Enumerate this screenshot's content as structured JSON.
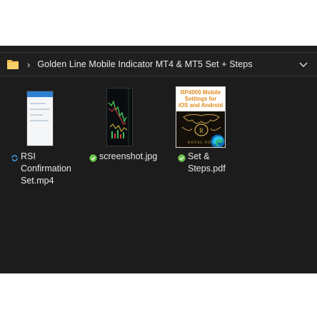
{
  "address_bar": {
    "separator": "›",
    "path": "Golden Line Mobile Indicator MT4 & MT5 Set + Steps",
    "folder_icon": "folder-icon",
    "expand_icon": "chevron-down-icon"
  },
  "files": [
    {
      "name_line1": "RSI",
      "name_line2": "Confirmation",
      "name_line3": "Set.mp4",
      "status_icon": "sync-icon",
      "status_color": "#3b9be6"
    },
    {
      "name_line1": "screenshot.jpg",
      "status_icon": "check-circle-icon",
      "status_color": "#6cc24a"
    },
    {
      "name_line1": "Set &",
      "name_line2": "Steps.pdf",
      "status_icon": "check-circle-icon",
      "status_color": "#6cc24a",
      "thumbnail_text_line1": "RP4000 Mobile",
      "thumbnail_text_line2": "Settings for",
      "thumbnail_text_line3": "iOS and Android",
      "thumbnail_brand": "ROYAL PIPS",
      "overlay_icon": "edge-browser-icon"
    }
  ],
  "colors": {
    "background": "#1c1c1c",
    "text": "#e9e9e9",
    "folder": "#f2c14e"
  }
}
